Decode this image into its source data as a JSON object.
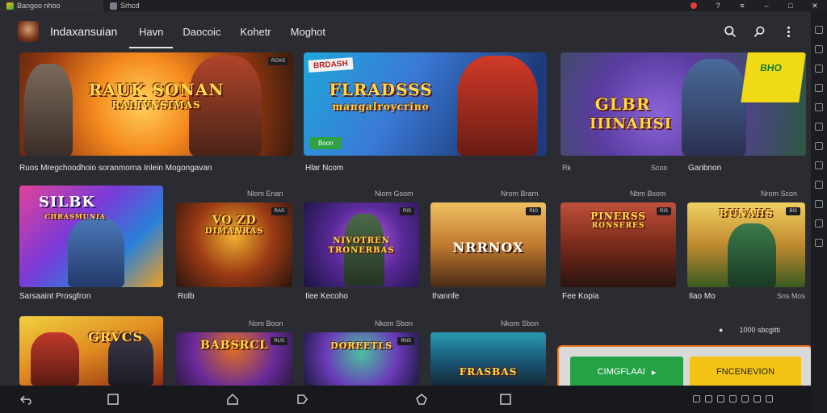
{
  "titlebar": {
    "tabs": [
      {
        "label": "Bangoo nhoo",
        "icon": "app-logo-icon"
      },
      {
        "label": "Srhcd",
        "icon": "home-icon"
      }
    ],
    "controls": [
      "record-icon",
      "help-icon",
      "menu-icon",
      "minimize-icon",
      "maximize-icon",
      "close-icon"
    ]
  },
  "nav": {
    "brand": "Indaxansuian",
    "tabs": [
      {
        "label": "Havn",
        "active": true
      },
      {
        "label": "Daocoic",
        "active": false
      },
      {
        "label": "Kohetr",
        "active": false
      },
      {
        "label": "Moghot",
        "active": false
      }
    ],
    "actions": [
      "search-icon",
      "search-alt-icon",
      "more-vert-icon"
    ]
  },
  "featured": [
    {
      "title_line1": "RAUK SONAN",
      "title_line2": "RALIVNSIMAS",
      "tag": "ROXS",
      "caption": "Ruos Mregchoodhoio soranmorna Inlein Mogongavan",
      "meta": ""
    },
    {
      "title_line1": "FLRADSSS",
      "title_line2": "mangalroycrino",
      "badge": "BRDASH",
      "button": "Boon",
      "caption": "Hlar Ncom",
      "meta": ""
    },
    {
      "title_line1": "GLBR",
      "title_line2": "IIINAHSI",
      "banner": "BHO",
      "caption": "Ganbnon",
      "meta": "Rk",
      "meta2": "Scoo"
    }
  ],
  "row2": [
    {
      "title_line1": "SILBK",
      "title_line2": "CHRASMUNIA",
      "tag": "",
      "meta": "",
      "caption": "Sarsaaint Prosgfron"
    },
    {
      "title_line1": "VO ZD",
      "title_line2": "DIMANRAS",
      "tag": "RAS",
      "meta": "Nlom Enan",
      "caption": "Rolb"
    },
    {
      "title_line1": "NIVOTREN",
      "title_line2": "TRONERBAS",
      "tag": "RIS",
      "meta": "Niom Gsom",
      "caption": "Ilee Kecoho"
    },
    {
      "title_line1": "NRRNOX",
      "title_line2": "",
      "tag": "RIO",
      "meta": "Nrom Brarn",
      "caption": "Ihannfe"
    },
    {
      "title_line1": "PINERSS",
      "title_line2": "RONSERES",
      "tag": "RIS",
      "meta": "Nbm Bxom",
      "caption": "Fee Kopia"
    },
    {
      "title_line1": "BUNAHS",
      "title_line2": "",
      "tag": "BIS",
      "meta": "Nrom Scon",
      "caption": "Ilao Mo",
      "meta2": "Sns Mos"
    }
  ],
  "row3": [
    {
      "title_line1": "GRVCS",
      "tag": "",
      "meta": ""
    },
    {
      "title_line1": "BABSRCL",
      "tag": "RUS",
      "meta": "Nom Boon"
    },
    {
      "title_line1": "DOREETLS",
      "tag": "RNS",
      "meta": "Nkom Sbon"
    },
    {
      "title_line1": "FRASBAS",
      "tag": "",
      "meta": "Nkom Sbon"
    }
  ],
  "cta": {
    "count_label": "1000 sbcgitti",
    "primary_label": "CIMGFLAAI",
    "secondary_label": "FNCENEVION",
    "primary_arrow": "▸"
  },
  "colors": {
    "accent_orange": "#f07a20",
    "cta_green": "#25a245",
    "cta_yellow": "#f2c316"
  }
}
